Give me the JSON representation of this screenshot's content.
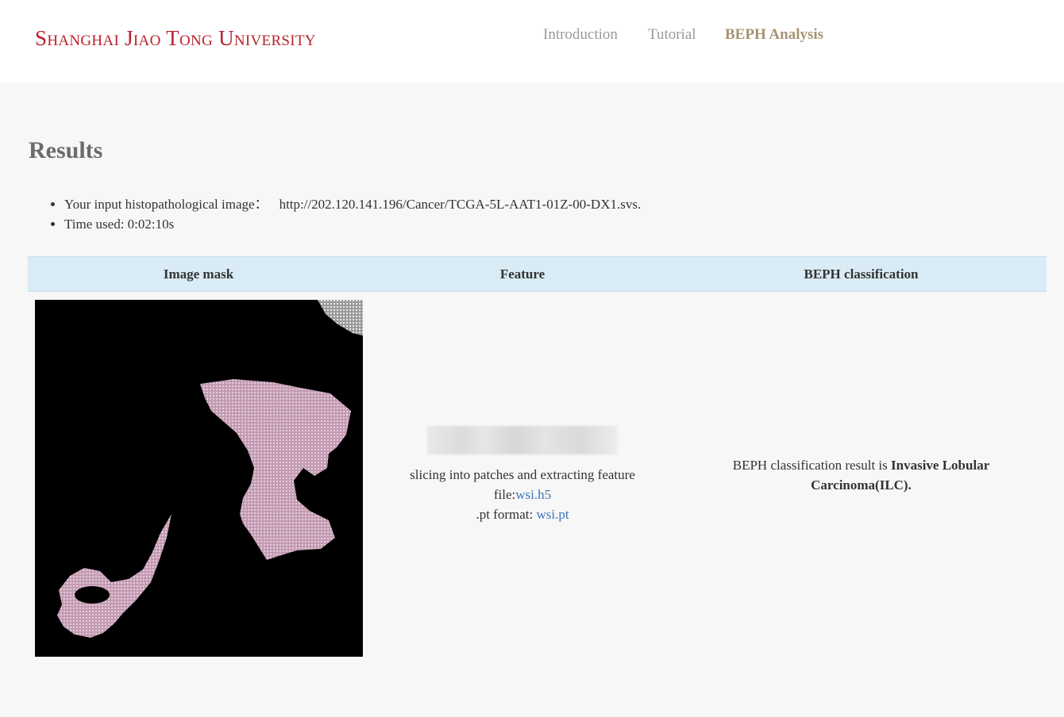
{
  "header": {
    "brand": "Shanghai Jiao Tong University",
    "nav": [
      {
        "label": "Introduction",
        "active": false
      },
      {
        "label": "Tutorial",
        "active": false
      },
      {
        "label": "BEPH Analysis",
        "active": true
      }
    ]
  },
  "main": {
    "title": "Results",
    "info": {
      "input_label": "Your input histopathological image：",
      "input_url": "http://202.120.141.196/Cancer/TCGA-5L-AAT1-01Z-00-DX1.svs.",
      "time_label": "Time used: 0:02:10s"
    },
    "table": {
      "headers": [
        "Image mask",
        "Feature",
        "BEPH classification"
      ],
      "feature": {
        "line1": "slicing into patches and extracting feature",
        "file_prefix": "file:",
        "file_link": "wsi.h5",
        "pt_prefix": ".pt format: ",
        "pt_link": "wsi.pt"
      },
      "classification": {
        "prefix": "BEPH classification result is ",
        "result": "Invasive Lobular Carcinoma(ILC)."
      }
    }
  },
  "colors": {
    "brand": "#b8222b",
    "nav_active": "#a89272",
    "header_row": "#d9ebf5",
    "link": "#3a78b8",
    "tissue": "#c9a0b6"
  }
}
